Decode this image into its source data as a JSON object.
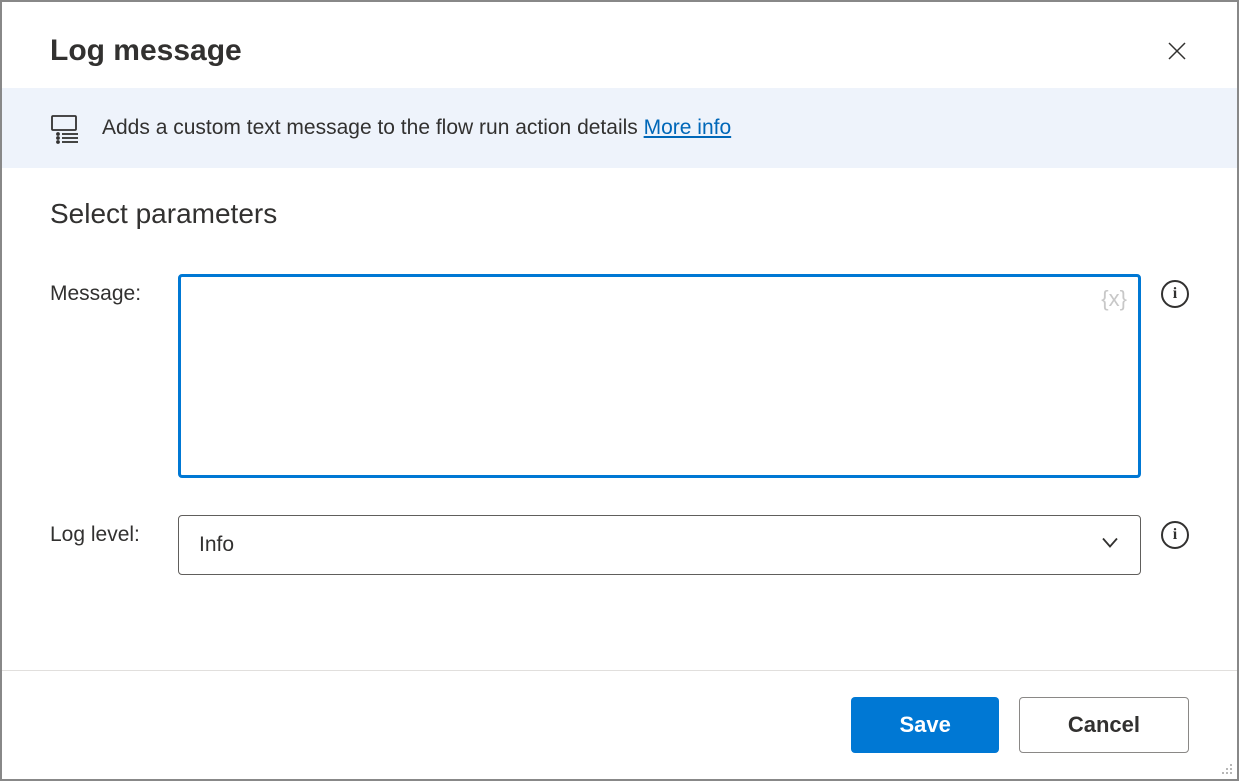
{
  "header": {
    "title": "Log message"
  },
  "banner": {
    "description": "Adds a custom text message to the flow run action details ",
    "link_label": "More info"
  },
  "section": {
    "title": "Select parameters"
  },
  "params": {
    "message": {
      "label": "Message:",
      "value": ""
    },
    "log_level": {
      "label": "Log level:",
      "value": "Info"
    }
  },
  "footer": {
    "save_label": "Save",
    "cancel_label": "Cancel"
  },
  "icons": {
    "variable_glyph": "{x}",
    "info_letter": "i"
  }
}
